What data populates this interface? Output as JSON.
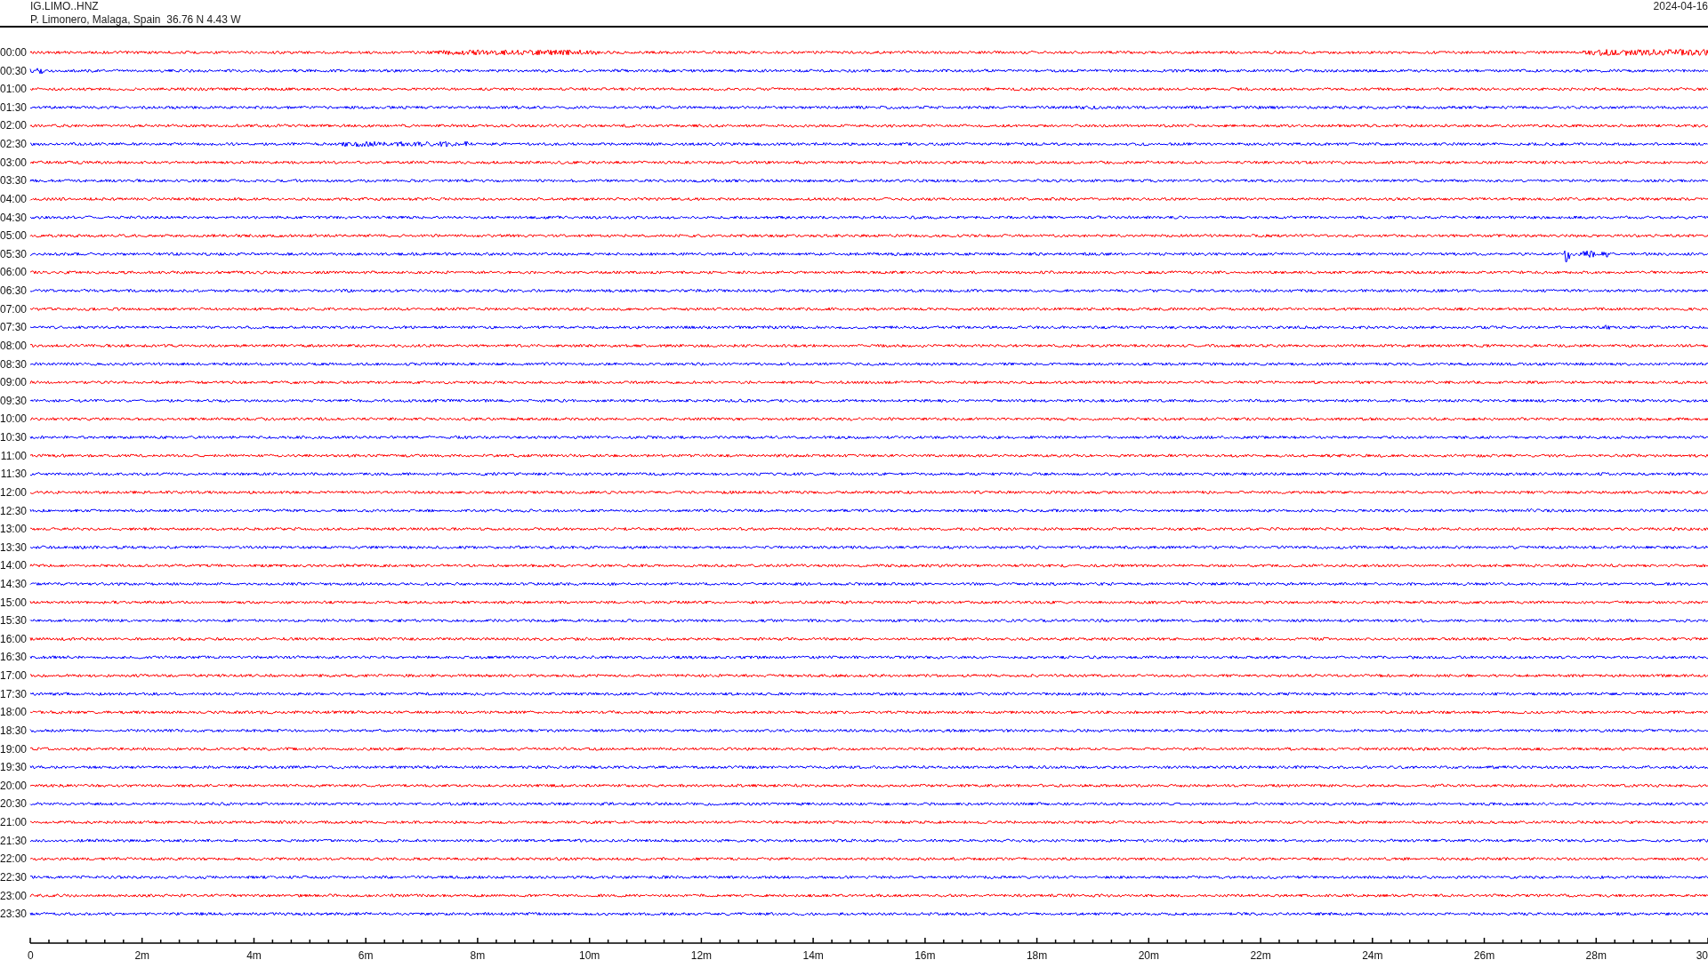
{
  "header": {
    "station": "IG.LIMO..HNZ",
    "location": "P. Limonero, Malaga, Spain  36.76 N 4.43 W",
    "date": "2024-04-16"
  },
  "rows": [
    {
      "label": "00:00",
      "color": "#ff0000"
    },
    {
      "label": "00:30",
      "color": "#0000ff"
    },
    {
      "label": "01:00",
      "color": "#ff0000"
    },
    {
      "label": "01:30",
      "color": "#0000ff"
    },
    {
      "label": "02:00",
      "color": "#ff0000"
    },
    {
      "label": "02:30",
      "color": "#0000ff"
    },
    {
      "label": "03:00",
      "color": "#ff0000"
    },
    {
      "label": "03:30",
      "color": "#0000ff"
    },
    {
      "label": "04:00",
      "color": "#ff0000"
    },
    {
      "label": "04:30",
      "color": "#0000ff"
    },
    {
      "label": "05:00",
      "color": "#ff0000"
    },
    {
      "label": "05:30",
      "color": "#0000ff"
    },
    {
      "label": "06:00",
      "color": "#ff0000"
    },
    {
      "label": "06:30",
      "color": "#0000ff"
    },
    {
      "label": "07:00",
      "color": "#ff0000"
    },
    {
      "label": "07:30",
      "color": "#0000ff"
    },
    {
      "label": "08:00",
      "color": "#ff0000"
    },
    {
      "label": "08:30",
      "color": "#0000ff"
    },
    {
      "label": "09:00",
      "color": "#ff0000"
    },
    {
      "label": "09:30",
      "color": "#0000ff"
    },
    {
      "label": "10:00",
      "color": "#ff0000"
    },
    {
      "label": "10:30",
      "color": "#0000ff"
    },
    {
      "label": "11:00",
      "color": "#ff0000"
    },
    {
      "label": "11:30",
      "color": "#0000ff"
    },
    {
      "label": "12:00",
      "color": "#ff0000"
    },
    {
      "label": "12:30",
      "color": "#0000ff"
    },
    {
      "label": "13:00",
      "color": "#ff0000"
    },
    {
      "label": "13:30",
      "color": "#0000ff"
    },
    {
      "label": "14:00",
      "color": "#ff0000"
    },
    {
      "label": "14:30",
      "color": "#0000ff"
    },
    {
      "label": "15:00",
      "color": "#ff0000"
    },
    {
      "label": "15:30",
      "color": "#0000ff"
    },
    {
      "label": "16:00",
      "color": "#ff0000"
    },
    {
      "label": "16:30",
      "color": "#0000ff"
    },
    {
      "label": "17:00",
      "color": "#ff0000"
    },
    {
      "label": "17:30",
      "color": "#0000ff"
    },
    {
      "label": "18:00",
      "color": "#ff0000"
    },
    {
      "label": "18:30",
      "color": "#0000ff"
    },
    {
      "label": "19:00",
      "color": "#ff0000"
    },
    {
      "label": "19:30",
      "color": "#0000ff"
    },
    {
      "label": "20:00",
      "color": "#ff0000"
    },
    {
      "label": "20:30",
      "color": "#0000ff"
    },
    {
      "label": "21:00",
      "color": "#ff0000"
    },
    {
      "label": "21:30",
      "color": "#0000ff"
    },
    {
      "label": "22:00",
      "color": "#ff0000"
    },
    {
      "label": "22:30",
      "color": "#0000ff"
    },
    {
      "label": "23:00",
      "color": "#ff0000"
    },
    {
      "label": "23:30",
      "color": "#0000ff"
    }
  ],
  "axis_labels": [
    "0",
    "2m",
    "4m",
    "6m",
    "8m",
    "10m",
    "12m",
    "14m",
    "16m",
    "18m",
    "20m",
    "22m",
    "24m",
    "26m",
    "28m",
    "30"
  ]
}
